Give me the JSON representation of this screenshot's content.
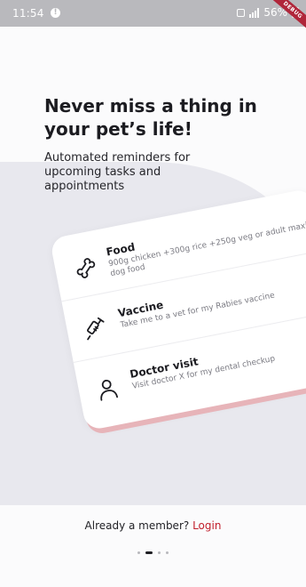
{
  "status_bar": {
    "time": "11:54",
    "alert_glyph": "!",
    "network_label": "56%",
    "icons": [
      "alert-icon",
      "camera-icon",
      "signal-icon",
      "battery-icon"
    ]
  },
  "debug_banner": "DEBUG",
  "onboarding": {
    "headline": "Never miss a thing in your pet’s life!",
    "subtitle": "Automated reminders for upcoming tasks and appointments"
  },
  "tasks": [
    {
      "icon": "bone-icon",
      "title": "Food",
      "description": "900g chicken +300g rice +250g veg or adult maxi dog food"
    },
    {
      "icon": "syringe-icon",
      "title": "Vaccine",
      "description": "Take me to a vet for my Rabies vaccine"
    },
    {
      "icon": "person-icon",
      "title": "Doctor visit",
      "description": "Visit doctor X for my dental checkup"
    }
  ],
  "footer": {
    "member_prompt": "Already a member?",
    "login_label": "Login"
  },
  "pager": {
    "total": 4,
    "active_index": 1
  },
  "colors": {
    "accent": "#c11f2c",
    "card_shadow": "#e7b4b9",
    "background_shape": "#e8e8ee",
    "status_bar": "#b9b9bd"
  }
}
